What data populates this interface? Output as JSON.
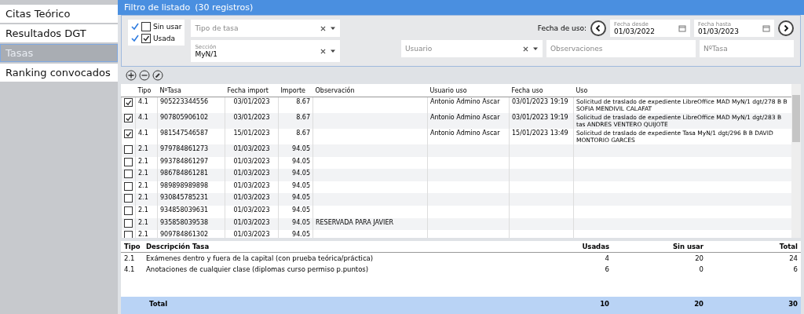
{
  "sidebar": {
    "items": [
      {
        "label": "Citas Teórico",
        "selected": false
      },
      {
        "label": "Resultados DGT",
        "selected": false
      },
      {
        "label": "Tasas",
        "selected": true
      },
      {
        "label": "Ranking convocados",
        "selected": false
      }
    ]
  },
  "filter": {
    "title": "Filtro de listado",
    "count": "(30 registros)",
    "checks": [
      {
        "label": "Sin usar",
        "enabled": true,
        "checked": false
      },
      {
        "label": "Usada",
        "enabled": true,
        "checked": true
      }
    ],
    "tipo_tasa": {
      "placeholder": "Tipo de tasa"
    },
    "fecha_label": "Fecha de uso:",
    "fecha_desde": {
      "label": "Fecha desde",
      "value": "01/03/2022"
    },
    "fecha_hasta": {
      "label": "Fecha hasta",
      "value": "01/03/2023"
    },
    "seccion": {
      "label": "Sección",
      "value": "MyN/1"
    },
    "usuario": {
      "placeholder": "Usuario"
    },
    "observaciones": {
      "placeholder": "Observaciones"
    },
    "num_tasa": {
      "placeholder": "NºTasa"
    }
  },
  "table": {
    "columns": [
      "Tipo",
      "NºTasa",
      "Fecha import",
      "Importe",
      "Observación",
      "Usuario uso",
      "Fecha uso",
      "Uso"
    ],
    "rows": [
      {
        "checked": true,
        "tipo": "4.1",
        "num": "905223344556",
        "fecha": "03/01/2023",
        "importe": "8.67",
        "obs": "",
        "usuario": "Antonio Admino Ascar",
        "fecha_uso": "03/01/2023 19:19",
        "uso": "Solicitud de traslado de expediente LibreOffice MAD MyN/1 dgt/278 B B SOFIA MENDIVIL CALAFAT"
      },
      {
        "checked": true,
        "tipo": "4.1",
        "num": "907805906102",
        "fecha": "03/01/2023",
        "importe": "8.67",
        "obs": "",
        "usuario": "Antonio Admino Ascar",
        "fecha_uso": "03/01/2023 19:19",
        "uso": "Solicitud de traslado de expediente LibreOffice MAD MyN/1 dgt/283 B tas ANDRES VENTERO QUIJOTE"
      },
      {
        "checked": true,
        "tipo": "4.1",
        "num": "981547546587",
        "fecha": "15/01/2023",
        "importe": "8.67",
        "obs": "",
        "usuario": "Antonio Admino Ascar",
        "fecha_uso": "15/01/2023 13:49",
        "uso": "Solicitud de traslado de expediente Tasa MyN/1 dgt/296 B B DAVID MONTORIO GARCES"
      },
      {
        "checked": false,
        "tipo": "2.1",
        "num": "979784861273",
        "fecha": "01/03/2023",
        "importe": "94.05",
        "obs": "",
        "usuario": "",
        "fecha_uso": "",
        "uso": ""
      },
      {
        "checked": false,
        "tipo": "2.1",
        "num": "993784861297",
        "fecha": "01/03/2023",
        "importe": "94.05",
        "obs": "",
        "usuario": "",
        "fecha_uso": "",
        "uso": ""
      },
      {
        "checked": false,
        "tipo": "2.1",
        "num": "986784861281",
        "fecha": "01/03/2023",
        "importe": "94.05",
        "obs": "",
        "usuario": "",
        "fecha_uso": "",
        "uso": ""
      },
      {
        "checked": false,
        "tipo": "2.1",
        "num": "989898989898",
        "fecha": "01/03/2023",
        "importe": "94.05",
        "obs": "",
        "usuario": "",
        "fecha_uso": "",
        "uso": ""
      },
      {
        "checked": false,
        "tipo": "2.1",
        "num": "930845785231",
        "fecha": "01/03/2023",
        "importe": "94.05",
        "obs": "",
        "usuario": "",
        "fecha_uso": "",
        "uso": ""
      },
      {
        "checked": false,
        "tipo": "2.1",
        "num": "934858039631",
        "fecha": "01/03/2023",
        "importe": "94.05",
        "obs": "",
        "usuario": "",
        "fecha_uso": "",
        "uso": ""
      },
      {
        "checked": false,
        "tipo": "2.1",
        "num": "935858039538",
        "fecha": "01/03/2023",
        "importe": "94.05",
        "obs": "RESERVADA PARA JAVIER",
        "usuario": "",
        "fecha_uso": "",
        "uso": ""
      },
      {
        "checked": false,
        "tipo": "2.1",
        "num": "909784861302",
        "fecha": "01/03/2023",
        "importe": "94.05",
        "obs": "",
        "usuario": "",
        "fecha_uso": "",
        "uso": ""
      }
    ]
  },
  "summary": {
    "columns": [
      "Tipo",
      "Descripción Tasa",
      "Usadas",
      "Sin usar",
      "Total"
    ],
    "rows": [
      [
        "2.1",
        "Exámenes dentro y fuera de la capital (con prueba teórica/práctica)",
        "4",
        "20",
        "24"
      ],
      [
        "4.1",
        "Anotaciones de cualquier clase (diplomas curso permiso p.puntos)",
        "6",
        "0",
        "6"
      ]
    ],
    "total": [
      "Total",
      "10",
      "20",
      "30"
    ]
  }
}
